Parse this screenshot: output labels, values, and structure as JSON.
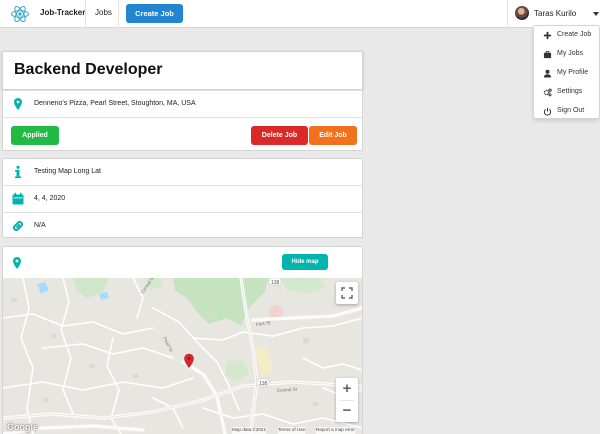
{
  "nav": {
    "brand": "Job-Tracker",
    "jobs": "Jobs",
    "create_job": "Create Job",
    "user_name": "Taras Kurilo"
  },
  "menu": {
    "items": [
      {
        "label": "Create Job",
        "icon": "plus-icon"
      },
      {
        "label": "My Jobs",
        "icon": "briefcase-icon"
      },
      {
        "label": "My Profile",
        "icon": "user-icon"
      },
      {
        "label": "Settings",
        "icon": "gears-icon"
      },
      {
        "label": "Sign Out",
        "icon": "power-icon"
      }
    ]
  },
  "job": {
    "title": "Backend Developer",
    "location": "Denneno's Pizza, Pearl Street, Stoughton, MA, USA",
    "status": "Applied",
    "delete_label": "Delete Job",
    "edit_label": "Edit Job",
    "description": "Testing Map Long Lat",
    "date": "4, 4, 2020",
    "link": "N/A"
  },
  "map": {
    "hide_label": "Hide map",
    "zoom_in": "+",
    "zoom_out": "−",
    "logo": "Google",
    "attribution": [
      "Map data ©2021",
      "Terms of Use",
      "Report a map error"
    ],
    "road_labels": [
      "Central St",
      "Pearl St",
      "Park St",
      "138",
      "138",
      "Central St"
    ]
  },
  "colors": {
    "accent": "#00b5ad",
    "primary": "#2185d0",
    "success": "#21ba45",
    "danger": "#db2828",
    "warning": "#f2711c"
  }
}
